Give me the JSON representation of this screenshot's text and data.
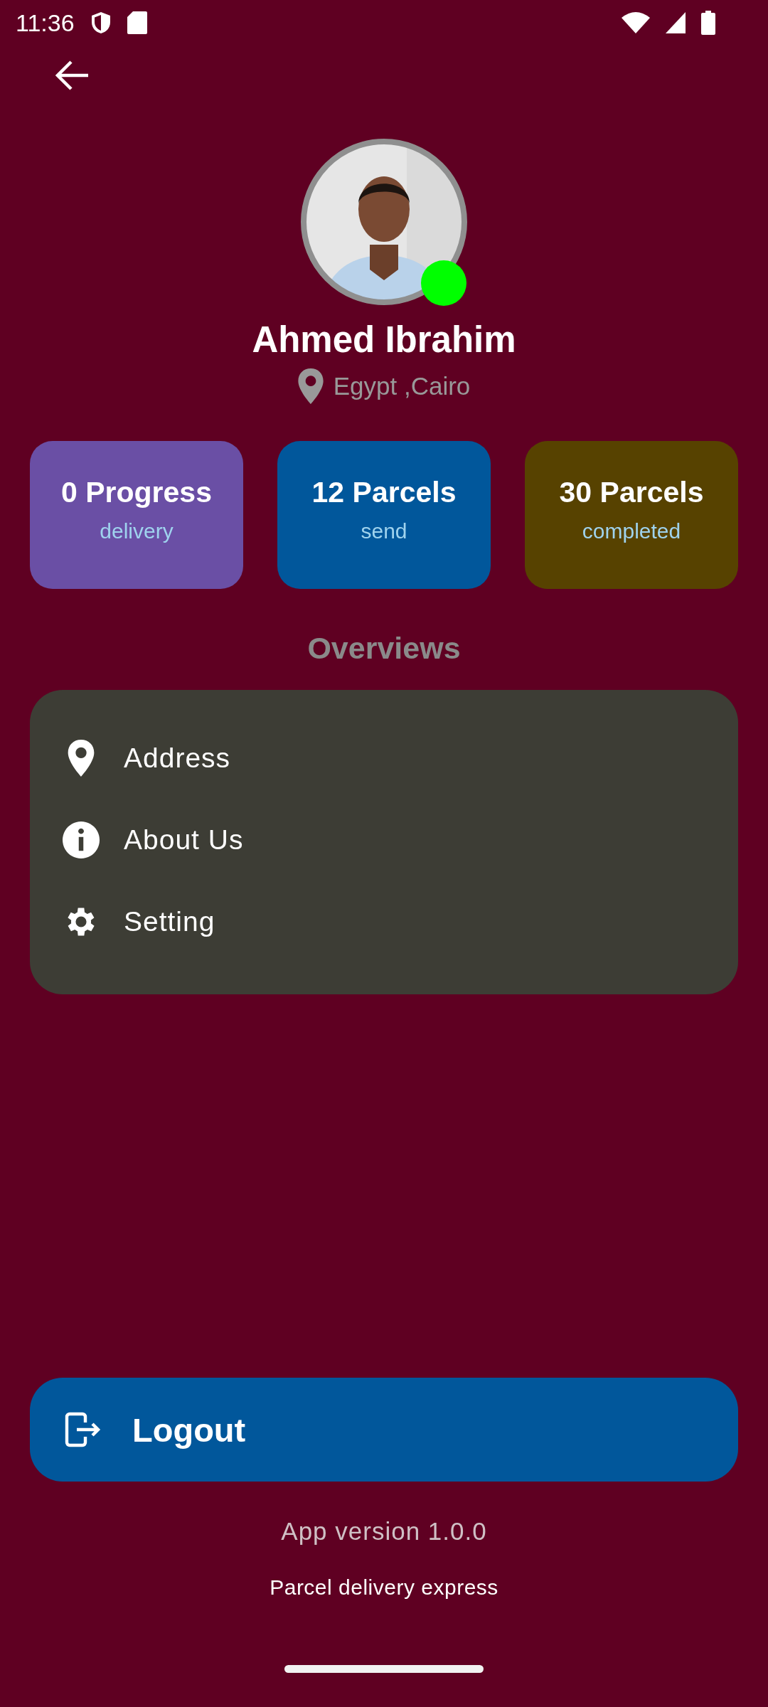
{
  "status_bar": {
    "time": "11:36"
  },
  "profile": {
    "name": "Ahmed Ibrahim",
    "location": "Egypt ,Cairo",
    "online": true
  },
  "stats": [
    {
      "value": "0 Progress",
      "label": "delivery",
      "color": "#6a4fa5"
    },
    {
      "value": "12 Parcels",
      "label": "send",
      "color": "#01579b"
    },
    {
      "value": "30 Parcels",
      "label": "completed",
      "color": "#574200"
    }
  ],
  "overviews": {
    "title": "Overviews",
    "items": [
      {
        "kind": "address",
        "label": "Address"
      },
      {
        "kind": "about",
        "label": "About Us"
      },
      {
        "kind": "setting",
        "label": "Setting"
      }
    ]
  },
  "logout": {
    "label": "Logout"
  },
  "footer": {
    "version": "App version 1.0.0",
    "tagline": "Parcel delivery express"
  }
}
